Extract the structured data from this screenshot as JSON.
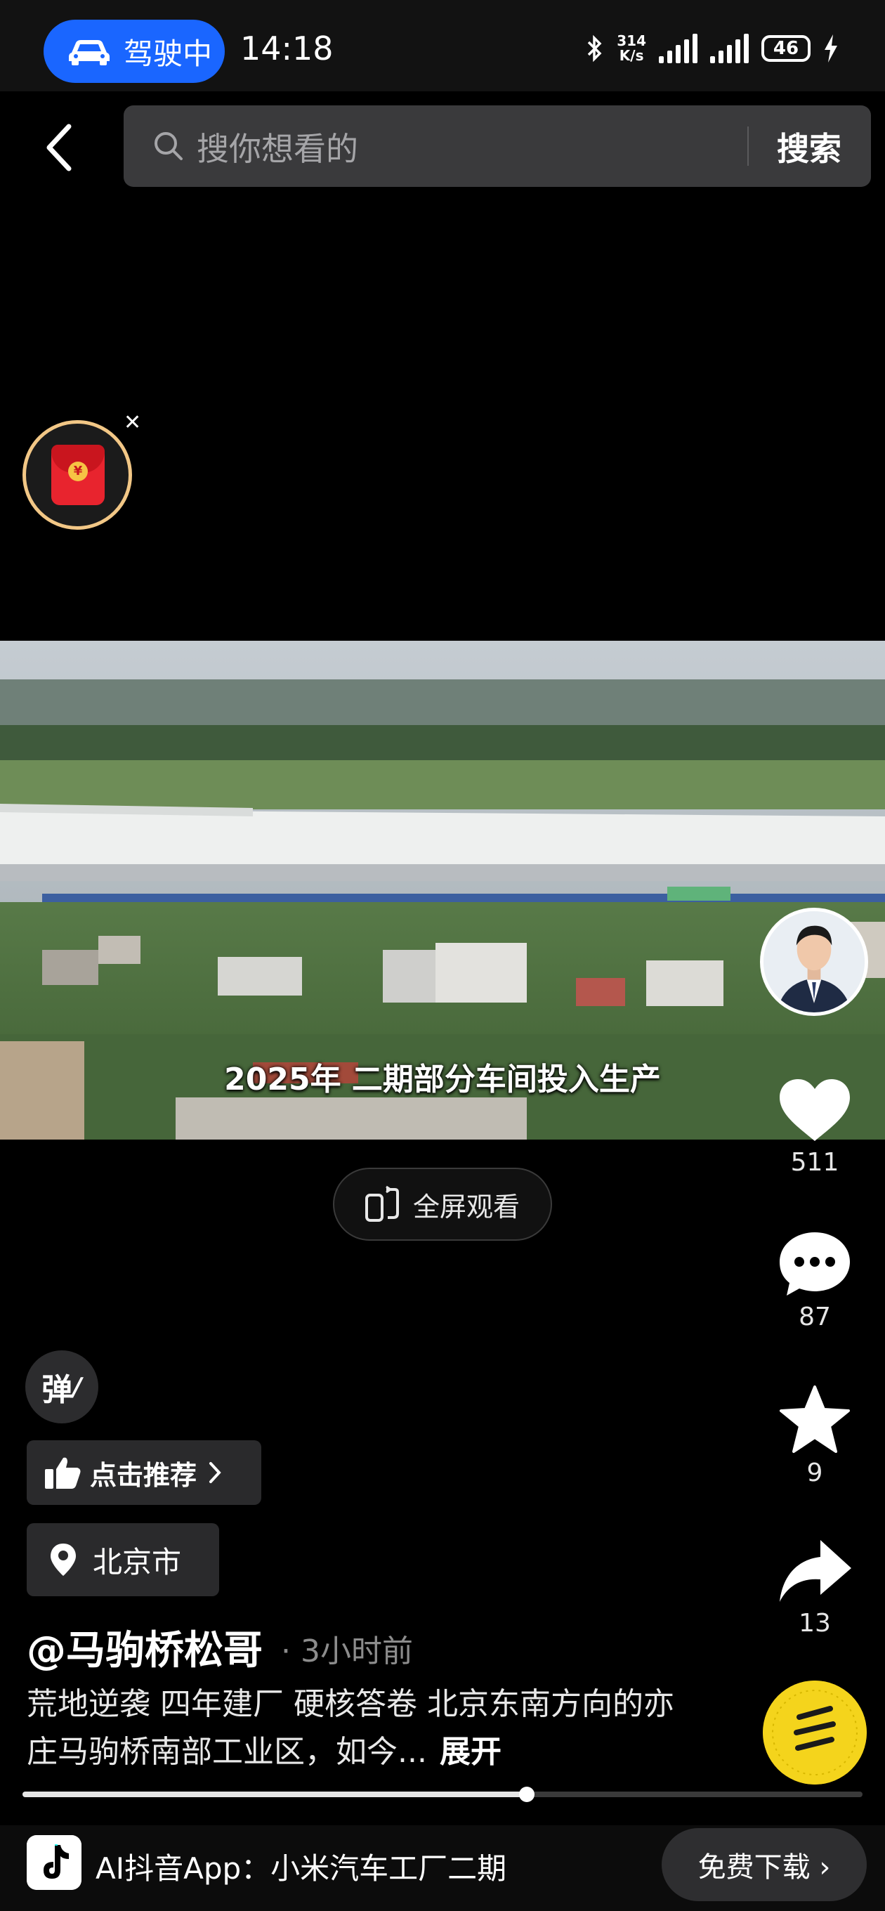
{
  "status_bar": {
    "driving_label": "驾驶中",
    "time": "14:18",
    "net_speed_value": "314",
    "net_speed_unit": "K/s",
    "battery": "46"
  },
  "search": {
    "placeholder": "搜你想看的",
    "button_label": "搜索"
  },
  "video": {
    "subtitle": "2025年 二期部分车间投入生产"
  },
  "actions": {
    "likes": "511",
    "comments": "87",
    "favorites": "9",
    "shares": "13"
  },
  "fullscreen_label": "全屏观看",
  "danmu_label": "弹",
  "recommend_label": "点击推荐",
  "location_label": "北京市",
  "post": {
    "author": "@马驹桥松哥",
    "time": "· 3小时前",
    "description": "荒地逆袭 四年建厂 硬核答卷 北京东南方向的亦庄马驹桥南部工业区，如今...",
    "expand_label": "展开"
  },
  "playback": {
    "progress": 0.6
  },
  "banner": {
    "text": "AI抖音App：小米汽车工厂二期",
    "download_label": "免费下载 ›"
  },
  "icons": {
    "back": "chevron-left-icon",
    "search": "search-icon",
    "like": "heart-icon",
    "comment": "comment-bubble-icon",
    "favorite": "star-icon",
    "share": "share-arrow-icon"
  },
  "colors": {
    "drive_pill": "#1a66ff",
    "red_packet": "#e8242e",
    "disc": "#f4d41c"
  }
}
